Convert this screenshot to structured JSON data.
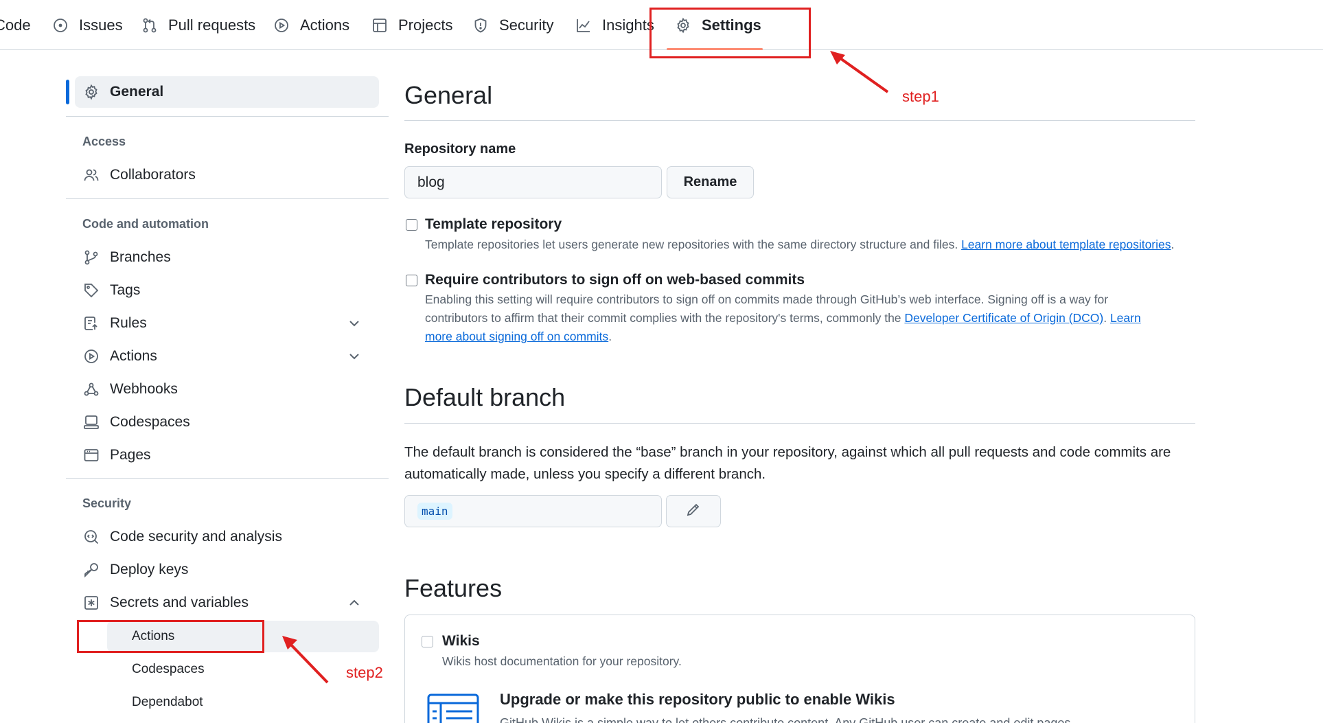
{
  "nav": {
    "tabs": [
      {
        "label": "Code",
        "icon": "code-icon"
      },
      {
        "label": "Issues",
        "icon": "issue-icon"
      },
      {
        "label": "Pull requests",
        "icon": "pull-request-icon"
      },
      {
        "label": "Actions",
        "icon": "play-icon"
      },
      {
        "label": "Projects",
        "icon": "table-icon"
      },
      {
        "label": "Security",
        "icon": "shield-icon"
      },
      {
        "label": "Insights",
        "icon": "graph-icon"
      },
      {
        "label": "Settings",
        "icon": "gear-icon",
        "active": true
      }
    ]
  },
  "sidebar": {
    "general": "General",
    "access_heading": "Access",
    "collaborators": "Collaborators",
    "code_heading": "Code and automation",
    "branches": "Branches",
    "tags": "Tags",
    "rules": "Rules",
    "actions": "Actions",
    "webhooks": "Webhooks",
    "codespaces": "Codespaces",
    "pages": "Pages",
    "security_heading": "Security",
    "code_security": "Code security and analysis",
    "deploy_keys": "Deploy keys",
    "secrets": "Secrets and variables",
    "sub_actions": "Actions",
    "sub_codespaces": "Codespaces",
    "sub_dependabot": "Dependabot"
  },
  "main": {
    "general_title": "General",
    "repo_name_label": "Repository name",
    "repo_name_value": "blog",
    "rename_button": "Rename",
    "template_title": "Template repository",
    "template_desc": "Template repositories let users generate new repositories with the same directory structure and files. ",
    "template_link": "Learn more about template repositories",
    "signoff_title": "Require contributors to sign off on web-based commits",
    "signoff_desc1": "Enabling this setting will require contributors to sign off on commits made through GitHub’s web interface. Signing off is a way for contributors to affirm that their commit complies with the repository's terms, commonly the ",
    "signoff_link1": "Developer Certificate of Origin (DCO)",
    "signoff_link2": "Learn more about signing off on commits",
    "default_branch_title": "Default branch",
    "default_branch_desc": "The default branch is considered the “base” branch in your repository, against which all pull requests and code commits are automatically made, unless you specify a different branch.",
    "default_branch_value": "main",
    "features_title": "Features",
    "wikis_title": "Wikis",
    "wikis_desc": "Wikis host documentation for your repository.",
    "upgrade_title": "Upgrade or make this repository public to enable Wikis",
    "upgrade_desc": "GitHub Wikis is a simple way to let others contribute content. Any GitHub user can create and edit pages"
  },
  "annotations": {
    "step1": "step1",
    "step2": "step2",
    "color": "#e02020"
  }
}
